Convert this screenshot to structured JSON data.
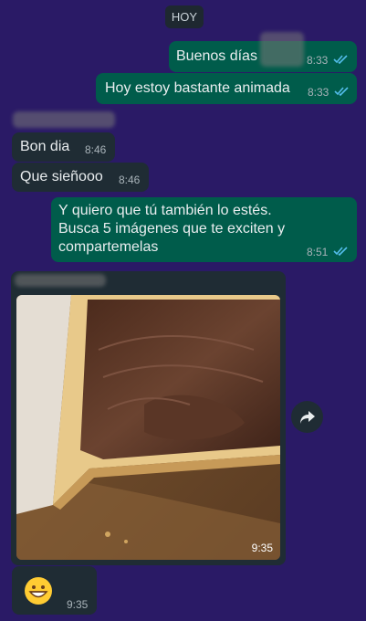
{
  "day_separator": "HOY",
  "messages": {
    "m1": {
      "text": "Buenos días",
      "time": "8:33"
    },
    "m2": {
      "text": "Hoy estoy bastante animada",
      "time": "8:33"
    },
    "m3": {
      "text": "Bon dia",
      "time": "8:46"
    },
    "m4": {
      "text": "Que sieñooo",
      "time": "8:46"
    },
    "m5": {
      "line1": "Y quiero que tú también lo estés.",
      "line2": "Busca 5 imágenes que te exciten y",
      "line3": "compartemelas",
      "time": "8:51"
    },
    "m6": {
      "time": "9:35",
      "image_icon": "bread-with-chocolate-spread-photo"
    },
    "m7": {
      "time": "9:35",
      "emoji": "grinning-face-emoji"
    }
  },
  "colors": {
    "background": "#2a1a66",
    "outgoing_bubble": "#005c4b",
    "incoming_bubble": "#1f2c34",
    "read_ticks": "#53bdeb"
  },
  "icons": {
    "forward": "forward-icon",
    "read_ticks": "double-check-icon"
  }
}
